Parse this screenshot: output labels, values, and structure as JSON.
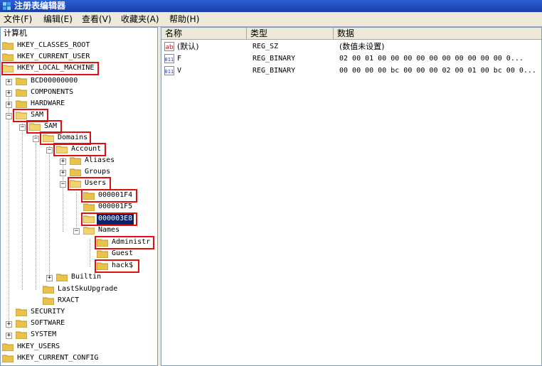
{
  "window": {
    "title": "注册表编辑器"
  },
  "menu": [
    "文件(F)",
    "编辑(E)",
    "查看(V)",
    "收藏夹(A)",
    "帮助(H)"
  ],
  "tree": {
    "root": "计算机",
    "nodes": [
      "HKEY_CLASSES_ROOT",
      "HKEY_CURRENT_USER",
      "HKEY_LOCAL_MACHINE",
      "BCD00000000",
      "COMPONENTS",
      "HARDWARE",
      "SAM",
      "SAM",
      "Domains",
      "Account",
      "Aliases",
      "Groups",
      "Users",
      "000001F4",
      "000001F5",
      "000003E8",
      "Names",
      "Administr",
      "Guest",
      "hack$",
      "Builtin",
      "LastSkuUpgrade",
      "RXACT",
      "SECURITY",
      "SOFTWARE",
      "SYSTEM",
      "HKEY_USERS",
      "HKEY_CURRENT_CONFIG"
    ],
    "expand_plus": "+",
    "expand_minus": "−"
  },
  "list": {
    "columns": [
      "名称",
      "类型",
      "数据"
    ],
    "rows": [
      {
        "icon": "string-value-icon",
        "icon_text": "ab",
        "name": "(默认)",
        "type": "REG_SZ",
        "data": "(数值未设置)"
      },
      {
        "icon": "binary-value-icon",
        "icon_text": "011",
        "name": "F",
        "type": "REG_BINARY",
        "data": "02 00 01 00 00 00 00 00 00 00 00 00 00 0..."
      },
      {
        "icon": "binary-value-icon",
        "icon_text": "011",
        "name": "V",
        "type": "REG_BINARY",
        "data": "00 00 00 00 bc 00 00 00 02 00 01 00 bc 00 0..."
      }
    ]
  },
  "colors": {
    "highlight_box": "#e01010",
    "selection": "#0a246a",
    "folder": "#e8c24a"
  }
}
